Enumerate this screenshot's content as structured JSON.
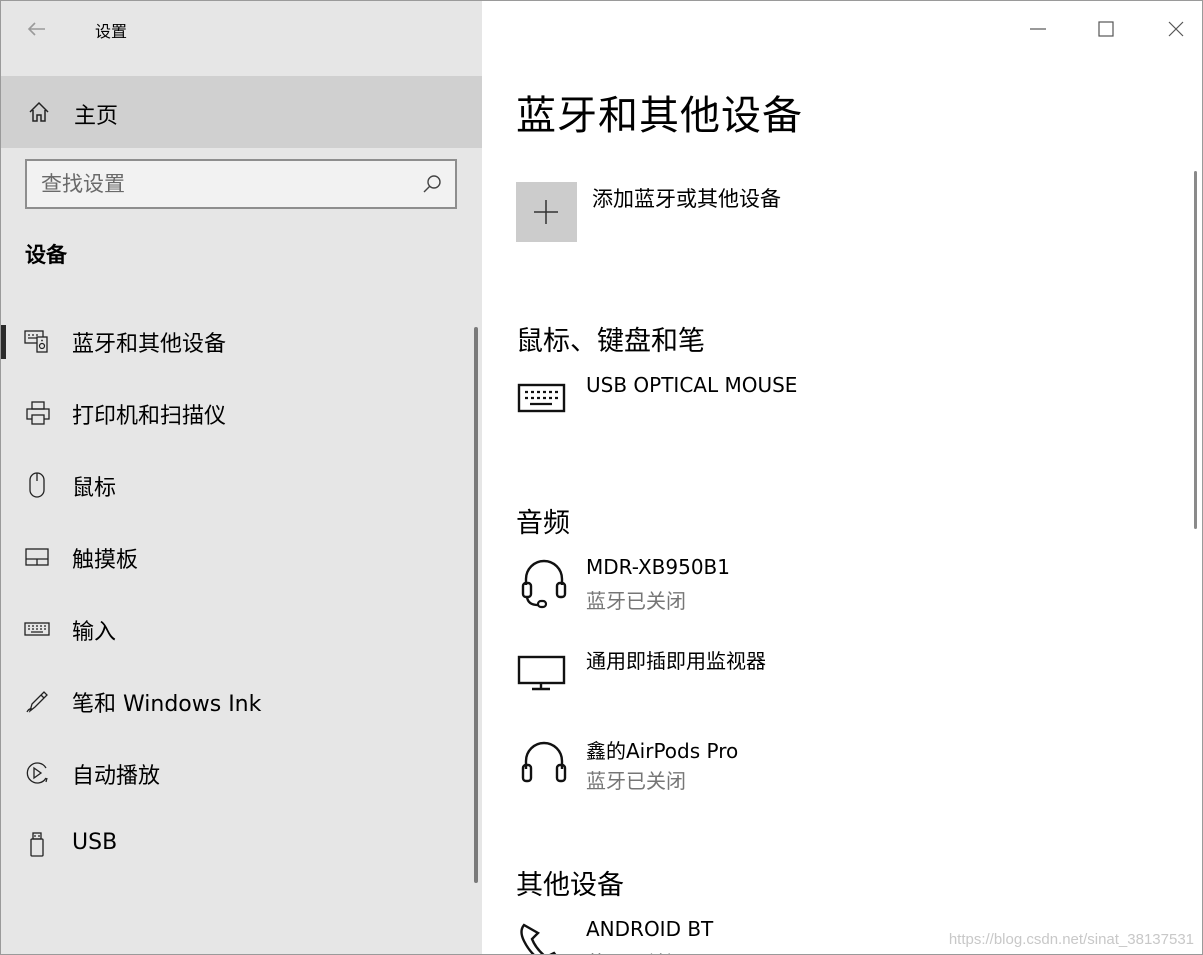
{
  "window": {
    "title": "设置"
  },
  "sidebar": {
    "home_label": "主页",
    "search": {
      "placeholder": "查找设置"
    },
    "section_title": "设备",
    "items": [
      {
        "label": "蓝牙和其他设备",
        "icon": "bluetooth-devices-icon",
        "selected": true
      },
      {
        "label": "打印机和扫描仪",
        "icon": "printer-icon",
        "selected": false
      },
      {
        "label": "鼠标",
        "icon": "mouse-icon",
        "selected": false
      },
      {
        "label": "触摸板",
        "icon": "touchpad-icon",
        "selected": false
      },
      {
        "label": "输入",
        "icon": "keyboard-icon",
        "selected": false
      },
      {
        "label": "笔和 Windows Ink",
        "icon": "pen-icon",
        "selected": false
      },
      {
        "label": "自动播放",
        "icon": "autoplay-icon",
        "selected": false
      },
      {
        "label": "USB",
        "icon": "usb-icon",
        "selected": false
      }
    ]
  },
  "main": {
    "title": "蓝牙和其他设备",
    "add_device_label": "添加蓝牙或其他设备",
    "groups": {
      "input": {
        "title": "鼠标、键盘和笔",
        "devices": [
          {
            "name": "USB OPTICAL MOUSE",
            "status": "",
            "icon": "keyboard-icon"
          }
        ]
      },
      "audio": {
        "title": "音频",
        "devices": [
          {
            "name": "MDR-XB950B1",
            "status": "蓝牙已关闭",
            "icon": "headset-icon"
          },
          {
            "name": "通用即插即用监视器",
            "status": "",
            "icon": "monitor-icon"
          },
          {
            "name": "鑫的AirPods Pro",
            "status": "蓝牙已关闭",
            "icon": "headphones-icon"
          }
        ]
      },
      "other": {
        "title": "其他设备",
        "devices": [
          {
            "name": "ANDROID BT",
            "status": "蓝牙已关闭",
            "icon": "phone-icon"
          }
        ]
      }
    }
  },
  "watermark": "https://blog.csdn.net/sinat_38137531"
}
